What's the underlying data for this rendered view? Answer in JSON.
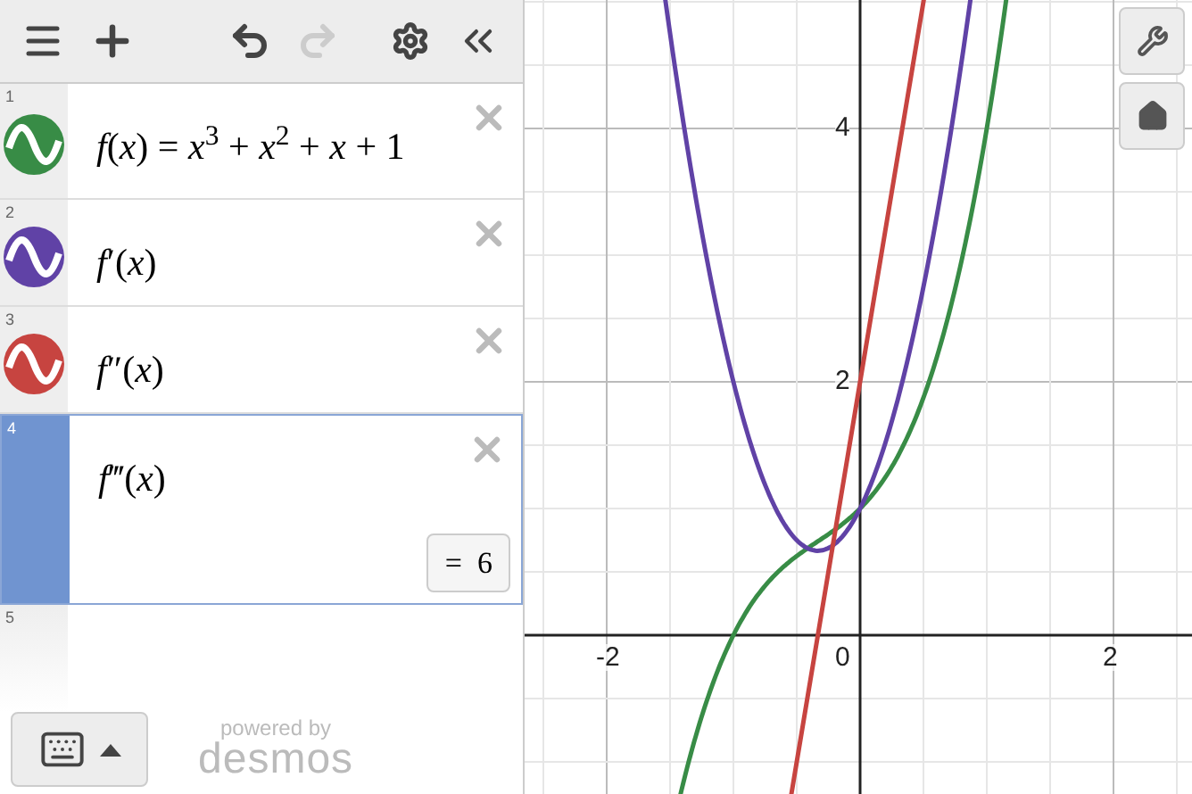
{
  "expressions": [
    {
      "number": "1",
      "latex": "*f*(*x*) = *x*$^{3}$ + *x*$^{2}$ + *x* + 1",
      "color": "#388c46",
      "selected": false
    },
    {
      "number": "2",
      "latex": "*f*′(*x*)",
      "color": "#6042a6",
      "selected": false
    },
    {
      "number": "3",
      "latex": "*f*″(*x*)",
      "color": "#c74440",
      "selected": false
    },
    {
      "number": "4",
      "latex": "*f*‴(*x*)",
      "selected": true,
      "value": "=  6"
    }
  ],
  "next_row_number": "5",
  "branding": {
    "line_1": "powered by",
    "line_2": "desmos"
  },
  "graph": {
    "x_tick_labels": [
      "-2",
      "0",
      "2"
    ],
    "y_tick_labels": [
      "4",
      "2"
    ]
  }
}
